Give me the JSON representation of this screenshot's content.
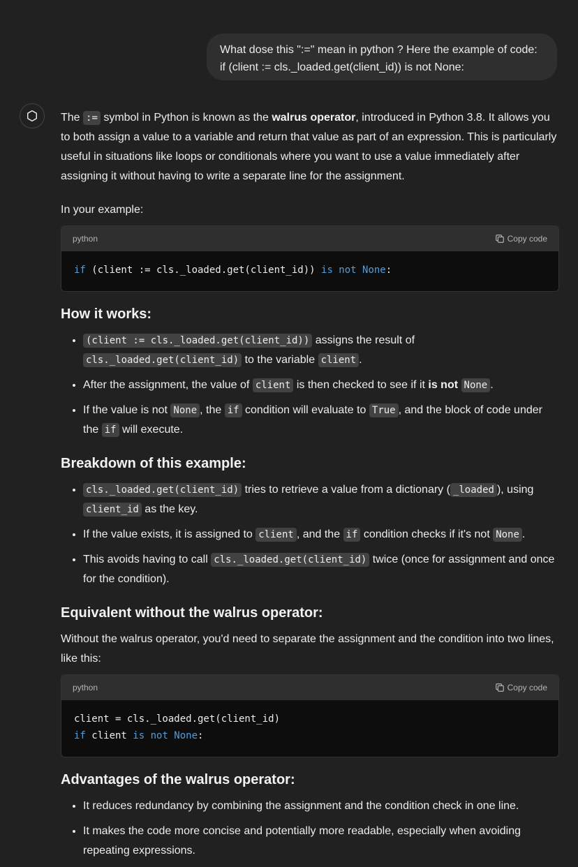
{
  "user_message": {
    "line1": "What dose this \":=\" mean in python ? Here the example of code:",
    "line2": "if (client := cls._loaded.get(client_id)) is not None:"
  },
  "assistant": {
    "intro": {
      "t1": "The ",
      "c1": ":=",
      "t2": " symbol in Python is known as the ",
      "b1": "walrus operator",
      "t3": ", introduced in Python 3.8. It allows you to both assign a value to a variable and return that value as part of an expression. This is particularly useful in situations like loops or conditionals where you want to use a value immediately after assigning it without having to write a separate line for the assignment."
    },
    "example_label": "In your example:",
    "code1": {
      "lang": "python",
      "copy_label": "Copy code",
      "l1_kw1": "if",
      "l1_mid": " (client := cls._loaded.get(client_id)) ",
      "l1_kw2": "is not None",
      "l1_end": ":"
    },
    "how": {
      "heading": "How it works:",
      "b1_c1": "(client := cls._loaded.get(client_id))",
      "b1_t1": " assigns the result of ",
      "b1_c2": "cls._loaded.get(client_id)",
      "b1_t2": " to the variable ",
      "b1_c3": "client",
      "b1_t3": ".",
      "b2_t1": "After the assignment, the value of ",
      "b2_c1": "client",
      "b2_t2": " is then checked to see if it ",
      "b2_b1": "is not",
      "b2_t3": " ",
      "b2_c2": "None",
      "b2_t4": ".",
      "b3_t1": "If the value is not ",
      "b3_c1": "None",
      "b3_t2": ", the ",
      "b3_c2": "if",
      "b3_t3": " condition will evaluate to ",
      "b3_c3": "True",
      "b3_t4": ", and the block of code under the ",
      "b3_c4": "if",
      "b3_t5": " will execute."
    },
    "breakdown": {
      "heading": "Breakdown of this example:",
      "b1_c1": "cls._loaded.get(client_id)",
      "b1_t1": " tries to retrieve a value from a dictionary (",
      "b1_c2": "_loaded",
      "b1_t2": "), using ",
      "b1_c3": "client_id",
      "b1_t3": " as the key.",
      "b2_t1": "If the value exists, it is assigned to ",
      "b2_c1": "client",
      "b2_t2": ", and the ",
      "b2_c2": "if",
      "b2_t3": " condition checks if it's not ",
      "b2_c3": "None",
      "b2_t4": ".",
      "b3_t1": "This avoids having to call ",
      "b3_c1": "cls._loaded.get(client_id)",
      "b3_t2": " twice (once for assignment and once for the condition)."
    },
    "equivalent": {
      "heading": "Equivalent without the walrus operator:",
      "text": "Without the walrus operator, you'd need to separate the assignment and the condition into two lines, like this:"
    },
    "code2": {
      "lang": "python",
      "copy_label": "Copy code",
      "l1": "client = cls._loaded.get(client_id)",
      "l2_kw1": "if",
      "l2_mid": " client ",
      "l2_kw2": "is not None",
      "l2_end": ":"
    },
    "advantages": {
      "heading": "Advantages of the walrus operator:",
      "b1": "It reduces redundancy by combining the assignment and the condition check in one line.",
      "b2": "It makes the code more concise and potentially more readable, especially when avoiding repeating expressions."
    }
  },
  "icons": {
    "assistant_avatar": "openai-logo-icon",
    "copy": "copy-icon"
  },
  "colors": {
    "background": "#212121",
    "bubble": "#2f2f2f",
    "keyword": "#569cd6"
  }
}
